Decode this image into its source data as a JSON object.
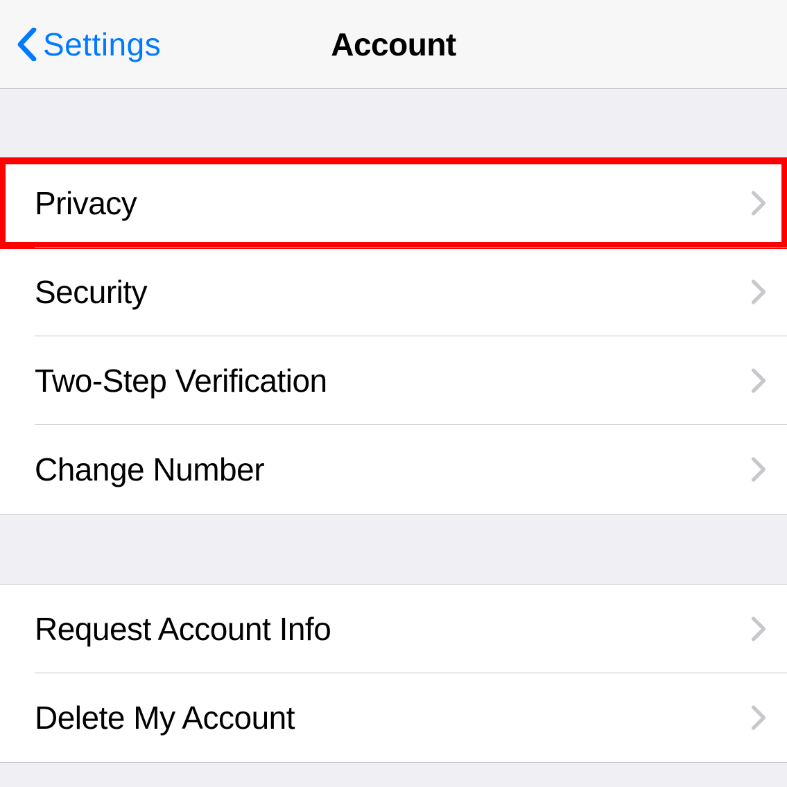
{
  "nav": {
    "back_label": "Settings",
    "title": "Account"
  },
  "sections": [
    {
      "items": [
        {
          "label": "Privacy",
          "highlighted": true
        },
        {
          "label": "Security",
          "highlighted": false
        },
        {
          "label": "Two-Step Verification",
          "highlighted": false
        },
        {
          "label": "Change Number",
          "highlighted": false
        }
      ]
    },
    {
      "items": [
        {
          "label": "Request Account Info",
          "highlighted": false
        },
        {
          "label": "Delete My Account",
          "highlighted": false
        }
      ]
    }
  ]
}
